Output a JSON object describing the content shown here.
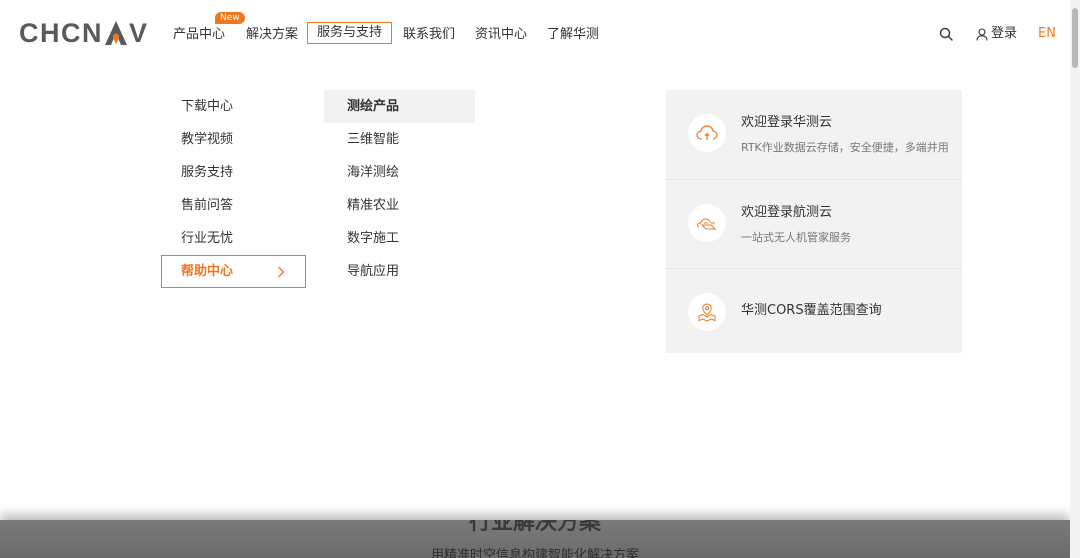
{
  "logo": {
    "text_left": "CHCN",
    "text_right": "V"
  },
  "nav": {
    "items": [
      {
        "label": "产品中心"
      },
      {
        "label": "解决方案"
      },
      {
        "label": "服务与支持"
      },
      {
        "label": "联系我们"
      },
      {
        "label": "资讯中心"
      },
      {
        "label": "了解华测"
      }
    ],
    "new_badge": "New",
    "search_icon": "search-icon",
    "login_label": "登录",
    "lang_label": "EN"
  },
  "menu": {
    "col1": [
      {
        "label": "下载中心"
      },
      {
        "label": "教学视频"
      },
      {
        "label": "服务支持"
      },
      {
        "label": "售前问答"
      },
      {
        "label": "行业无忧"
      },
      {
        "label": "帮助中心"
      }
    ],
    "col2": [
      {
        "label": "测绘产品"
      },
      {
        "label": "三维智能"
      },
      {
        "label": "海洋测绘"
      },
      {
        "label": "精准农业"
      },
      {
        "label": "数字施工"
      },
      {
        "label": "导航应用"
      }
    ],
    "cards": [
      {
        "title": "欢迎登录华测云",
        "desc": "RTK作业数据云存储，安全便捷，多端并用",
        "icon": "cloud-icon"
      },
      {
        "title": "欢迎登录航测云",
        "desc": "一站式无人机管家服务",
        "icon": "drone-cloud-icon"
      },
      {
        "title": "华测CORS覆盖范围查询",
        "desc": "",
        "icon": "map-pin-icon"
      }
    ]
  },
  "section": {
    "title": "行业解决方案",
    "subtitle": "用精准时空信息构建智能化解决方案"
  },
  "colors": {
    "accent": "#f0771f",
    "panel_bg": "#f2f2f2",
    "logo_gray": "#5a5a5a"
  }
}
